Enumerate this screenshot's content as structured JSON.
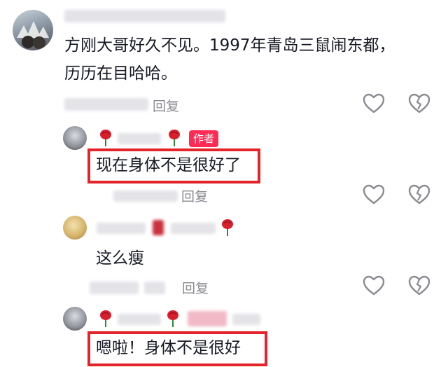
{
  "comments": [
    {
      "text_line1": "方刚大哥好久不见。1997年青岛三鼠闹东都，",
      "text_line2": "历历在目哈哈。",
      "reply_label": "回复"
    },
    {
      "author_badge": "作者",
      "text": "现在身体不是很好了",
      "reply_label": "回复"
    },
    {
      "text": "这么瘦",
      "reply_label": "回复"
    },
    {
      "text": "嗯啦！身体不是很好"
    }
  ],
  "colors": {
    "highlight": "#e3242b",
    "author_badge_bg": "#fe2c55",
    "meta_text": "#8a8b91"
  },
  "icons": [
    "heart-outline-icon",
    "heart-broken-icon",
    "rose-emoji-icon"
  ]
}
